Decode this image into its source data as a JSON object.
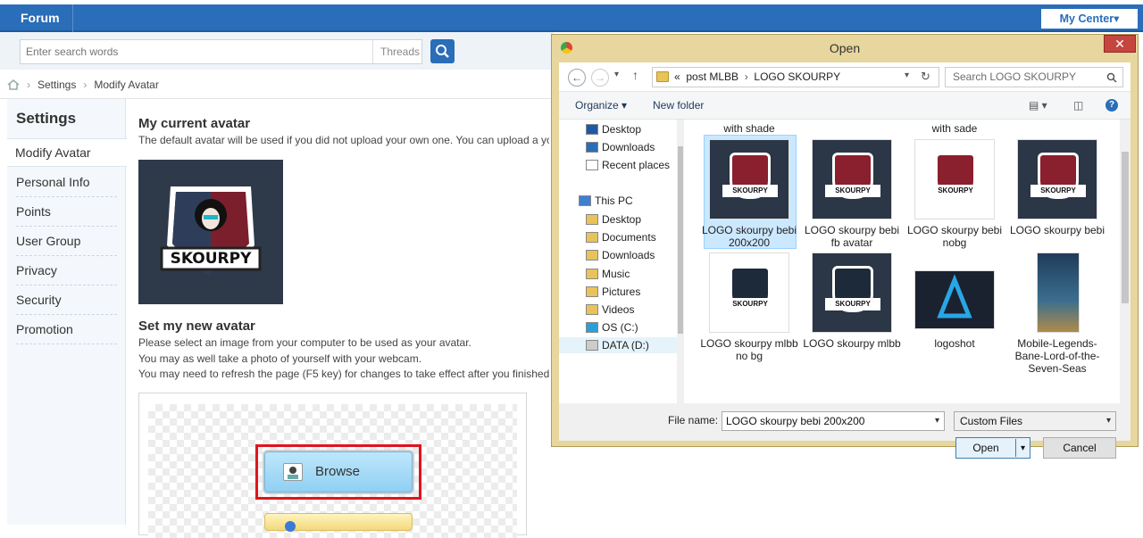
{
  "topbar": {
    "logo": "Forum",
    "my_center": "My Center▾"
  },
  "search": {
    "placeholder": "Enter search words",
    "scope": "Threads"
  },
  "breadcrumb": {
    "items": [
      "Settings",
      "Modify Avatar"
    ]
  },
  "sidebar": {
    "title": "Settings",
    "active": "Modify Avatar",
    "items": [
      "Personal Info",
      "Points",
      "User Group",
      "Privacy",
      "Security",
      "Promotion"
    ]
  },
  "main": {
    "current_title": "My current avatar",
    "current_desc": "The default avatar will be used if you did not upload your own one. You can upload a yo",
    "avatar_text": "SKOURPY",
    "new_title": "Set my new avatar",
    "new_desc": [
      "Please select an image from your computer to be used as your avatar.",
      "You may as well take a photo of yourself with your webcam.",
      "You may need to refresh the page (F5 key) for changes to take effect after you finished s"
    ],
    "browse_label": "Browse"
  },
  "dialog": {
    "title": "Open",
    "close": "✕",
    "path_prefix": "«",
    "path": [
      "post MLBB",
      "LOGO SKOURPY"
    ],
    "search_placeholder": "Search LOGO SKOURPY",
    "toolbar": {
      "organize": "Organize ▾",
      "new_folder": "New folder"
    },
    "nav": {
      "quick": [
        "Desktop",
        "Downloads",
        "Recent places"
      ],
      "this_pc": "This PC",
      "pc_items": [
        "Desktop",
        "Documents",
        "Downloads",
        "Music",
        "Pictures",
        "Videos",
        "OS (C:)",
        "DATA (D:)"
      ]
    },
    "files_top_captions": [
      "with shade",
      "with sade"
    ],
    "files": [
      {
        "name": "LOGO skourpy bebi 200x200",
        "selected": true
      },
      {
        "name": "LOGO skourpy bebi fb avatar"
      },
      {
        "name": "LOGO skourpy bebi nobg"
      },
      {
        "name": "LOGO skourpy bebi"
      },
      {
        "name": "LOGO skourpy mlbb no bg"
      },
      {
        "name": "LOGO skourpy mlbb"
      },
      {
        "name": "logoshot"
      },
      {
        "name": "Mobile-Legends-Bane-Lord-of-the-Seven-Seas"
      }
    ],
    "thumb_text": "SKOURPY",
    "file_name_label": "File name:",
    "file_name_value": "LOGO skourpy bebi 200x200",
    "file_type": "Custom Files",
    "open_label": "Open",
    "cancel_label": "Cancel"
  },
  "colors": {
    "accent": "#2a6db8",
    "dialog_frame": "#e7d69d",
    "highlight_red": "#e0141c"
  }
}
